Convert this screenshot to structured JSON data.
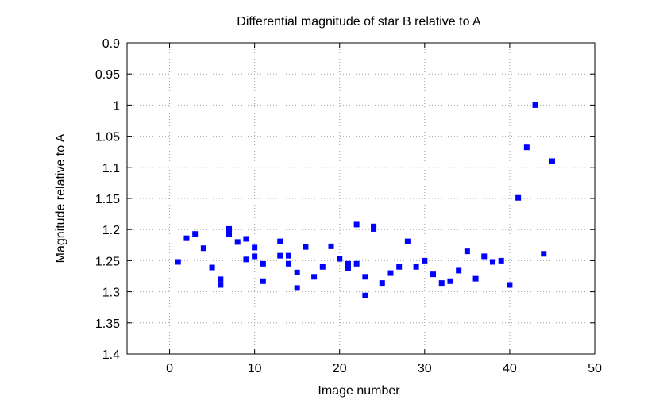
{
  "chart_data": {
    "type": "scatter",
    "title": "Differential magnitude of star B relative to A",
    "xlabel": "Image number",
    "ylabel": "Magnitude relative to A",
    "xlim": [
      -5,
      50
    ],
    "ylim": [
      0.9,
      1.4
    ],
    "y_inverted": true,
    "grid": true,
    "marker_color": "#0000ff",
    "marker": "square",
    "xticks": [
      0,
      10,
      20,
      30,
      40,
      50
    ],
    "xtick_labels": [
      "0",
      "10",
      "20",
      "30",
      "40",
      "50"
    ],
    "yticks": [
      0.9,
      0.95,
      1,
      1.05,
      1.1,
      1.15,
      1.2,
      1.25,
      1.3,
      1.35,
      1.4
    ],
    "ytick_labels": [
      "0.9",
      "0.95",
      "1",
      "1.05",
      "1.1",
      "1.15",
      "1.2",
      "1.25",
      "1.3",
      "1.35",
      "1.4"
    ],
    "points": [
      [
        1,
        1.252
      ],
      [
        2,
        1.214
      ],
      [
        3,
        1.207
      ],
      [
        4,
        1.23
      ],
      [
        5,
        1.261
      ],
      [
        6,
        1.28
      ],
      [
        6,
        1.289
      ],
      [
        7,
        1.199
      ],
      [
        7,
        1.207
      ],
      [
        8,
        1.22
      ],
      [
        9,
        1.215
      ],
      [
        9,
        1.248
      ],
      [
        10,
        1.229
      ],
      [
        10,
        1.243
      ],
      [
        11,
        1.255
      ],
      [
        11,
        1.283
      ],
      [
        13,
        1.219
      ],
      [
        13,
        1.242
      ],
      [
        14,
        1.242
      ],
      [
        14,
        1.255
      ],
      [
        15,
        1.269
      ],
      [
        15,
        1.294
      ],
      [
        16,
        1.228
      ],
      [
        17,
        1.276
      ],
      [
        18,
        1.26
      ],
      [
        19,
        1.227
      ],
      [
        20,
        1.247
      ],
      [
        21,
        1.255
      ],
      [
        21,
        1.262
      ],
      [
        22,
        1.192
      ],
      [
        22,
        1.255
      ],
      [
        23,
        1.276
      ],
      [
        23,
        1.306
      ],
      [
        24,
        1.195
      ],
      [
        24,
        1.199
      ],
      [
        25,
        1.286
      ],
      [
        26,
        1.27
      ],
      [
        27,
        1.26
      ],
      [
        28,
        1.219
      ],
      [
        29,
        1.26
      ],
      [
        30,
        1.25
      ],
      [
        31,
        1.272
      ],
      [
        32,
        1.286
      ],
      [
        33,
        1.283
      ],
      [
        34,
        1.266
      ],
      [
        35,
        1.235
      ],
      [
        36,
        1.279
      ],
      [
        37,
        1.243
      ],
      [
        38,
        1.252
      ],
      [
        39,
        1.25
      ],
      [
        40,
        1.289
      ],
      [
        41,
        1.149
      ],
      [
        42,
        1.068
      ],
      [
        43,
        1.0
      ],
      [
        44,
        1.239
      ],
      [
        45,
        1.09
      ]
    ]
  }
}
